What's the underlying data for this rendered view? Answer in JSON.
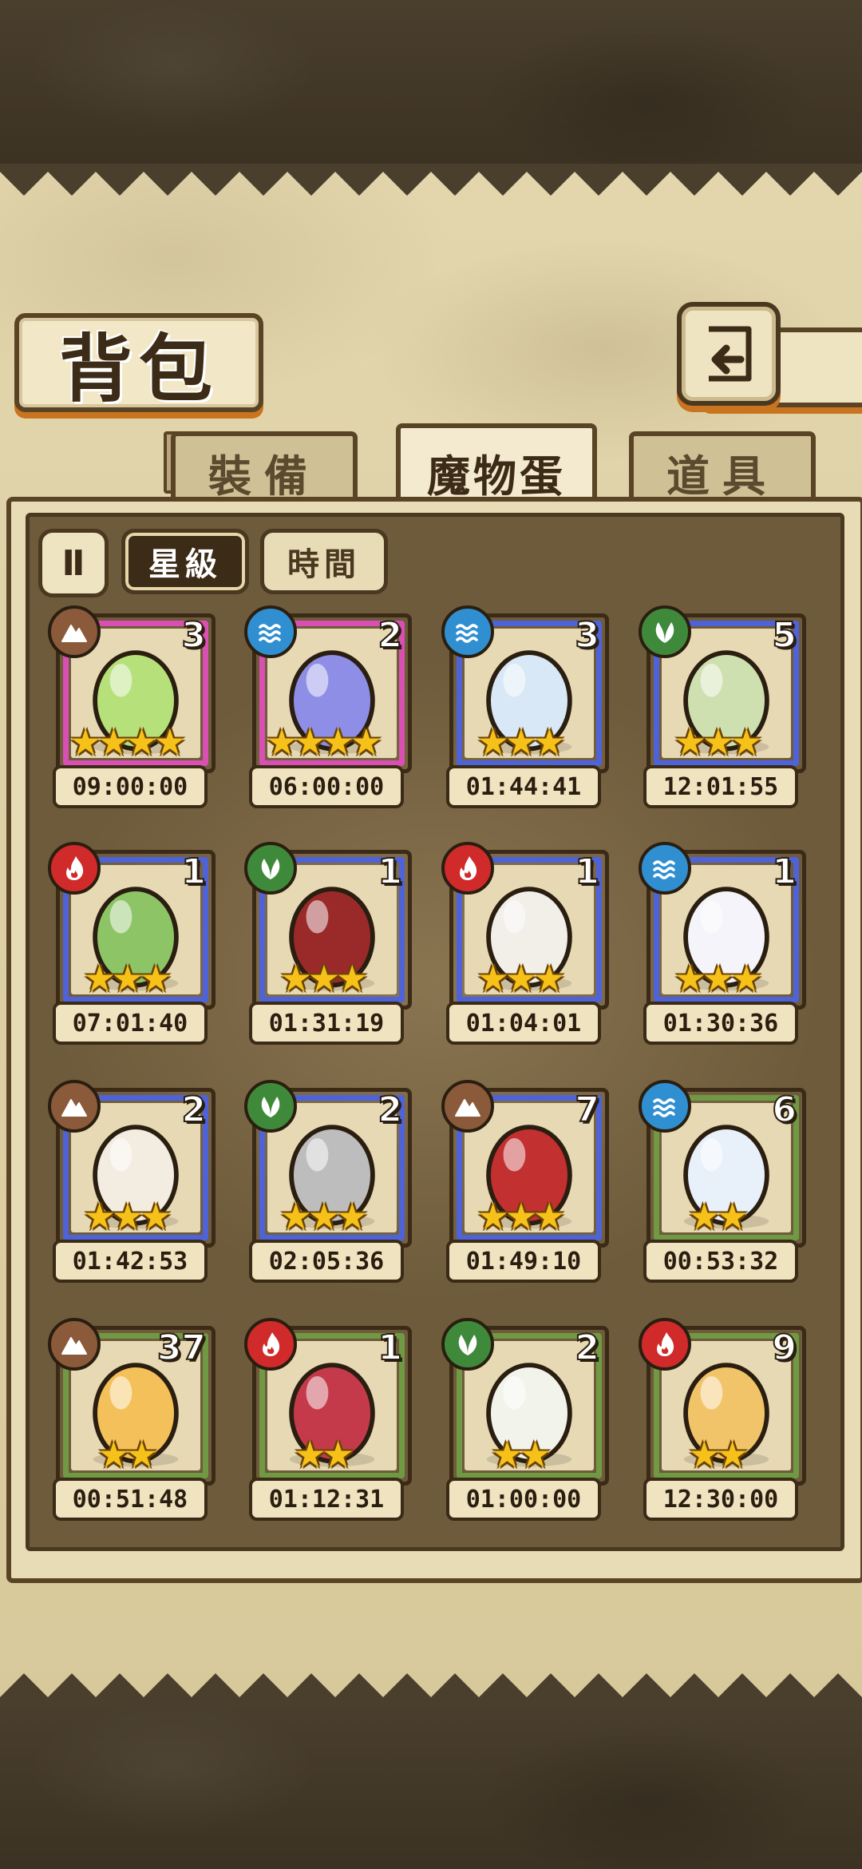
{
  "title": "背包",
  "tabs": [
    {
      "label": "裝備",
      "active": false
    },
    {
      "label": "魔物蛋",
      "active": true
    },
    {
      "label": "道具",
      "active": false
    }
  ],
  "sort": {
    "toggle_label": "Ⅱ",
    "star_label": "星級",
    "time_label": "時間",
    "active": "star"
  },
  "colors": {
    "rarity4": "#d94fb3",
    "rarity3": "#4f63d9",
    "rarity2": "#6f9a43",
    "earth": "#8a5a3a",
    "water": "#2f8fd0",
    "wood": "#3f8a3a",
    "fire": "#d02a2a"
  },
  "items": [
    {
      "name": "green-cracked-egg",
      "element": "earth",
      "count": "3",
      "stars": 4,
      "rarity": "rarity4",
      "timer": "09:00:00",
      "color": "#b6e07a"
    },
    {
      "name": "purple-fin-egg",
      "element": "water",
      "count": "2",
      "stars": 4,
      "rarity": "rarity4",
      "timer": "06:00:00",
      "color": "#8e8ee6"
    },
    {
      "name": "cloud-egg",
      "element": "water",
      "count": "3",
      "stars": 3,
      "rarity": "rarity3",
      "timer": "01:44:41",
      "color": "#d8e8f6"
    },
    {
      "name": "leaf-egg",
      "element": "wood",
      "count": "5",
      "stars": 3,
      "rarity": "rarity3",
      "timer": "12:01:55",
      "color": "#cfe0b0"
    },
    {
      "name": "cactus-egg",
      "element": "fire",
      "count": "1",
      "stars": 3,
      "rarity": "rarity3",
      "timer": "07:01:40",
      "color": "#8cc466"
    },
    {
      "name": "strawberry-egg",
      "element": "wood",
      "count": "1",
      "stars": 3,
      "rarity": "rarity3",
      "timer": "01:31:19",
      "color": "#9a2a2a"
    },
    {
      "name": "flame-egg",
      "element": "fire",
      "count": "1",
      "stars": 3,
      "rarity": "rarity3",
      "timer": "01:04:01",
      "color": "#f2eee8"
    },
    {
      "name": "bow-egg",
      "element": "water",
      "count": "1",
      "stars": 3,
      "rarity": "rarity3",
      "timer": "01:30:36",
      "color": "#f4f4fa"
    },
    {
      "name": "fluffy-egg",
      "element": "earth",
      "count": "2",
      "stars": 3,
      "rarity": "rarity3",
      "timer": "01:42:53",
      "color": "#f3ece0"
    },
    {
      "name": "spiked-helmet-egg",
      "element": "wood",
      "count": "2",
      "stars": 3,
      "rarity": "rarity3",
      "timer": "02:05:36",
      "color": "#bdbdbd"
    },
    {
      "name": "crested-helmet-egg",
      "element": "earth",
      "count": "7",
      "stars": 3,
      "rarity": "rarity3",
      "timer": "01:49:10",
      "color": "#c23030"
    },
    {
      "name": "planet-egg",
      "element": "water",
      "count": "6",
      "stars": 2,
      "rarity": "rarity2",
      "timer": "00:53:32",
      "color": "#e8f0fa"
    },
    {
      "name": "orange-swirl-egg",
      "element": "earth",
      "count": "37",
      "stars": 2,
      "rarity": "rarity2",
      "timer": "00:51:48",
      "color": "#f4c05a"
    },
    {
      "name": "red-swirl-egg",
      "element": "fire",
      "count": "1",
      "stars": 2,
      "rarity": "rarity2",
      "timer": "01:12:31",
      "color": "#c43a4a"
    },
    {
      "name": "turnip-egg",
      "element": "wood",
      "count": "2",
      "stars": 2,
      "rarity": "rarity2",
      "timer": "01:00:00",
      "color": "#f2f4ec"
    },
    {
      "name": "pudding-egg",
      "element": "fire",
      "count": "9",
      "stars": 2,
      "rarity": "rarity2",
      "timer": "12:30:00",
      "color": "#f2c46a"
    }
  ]
}
